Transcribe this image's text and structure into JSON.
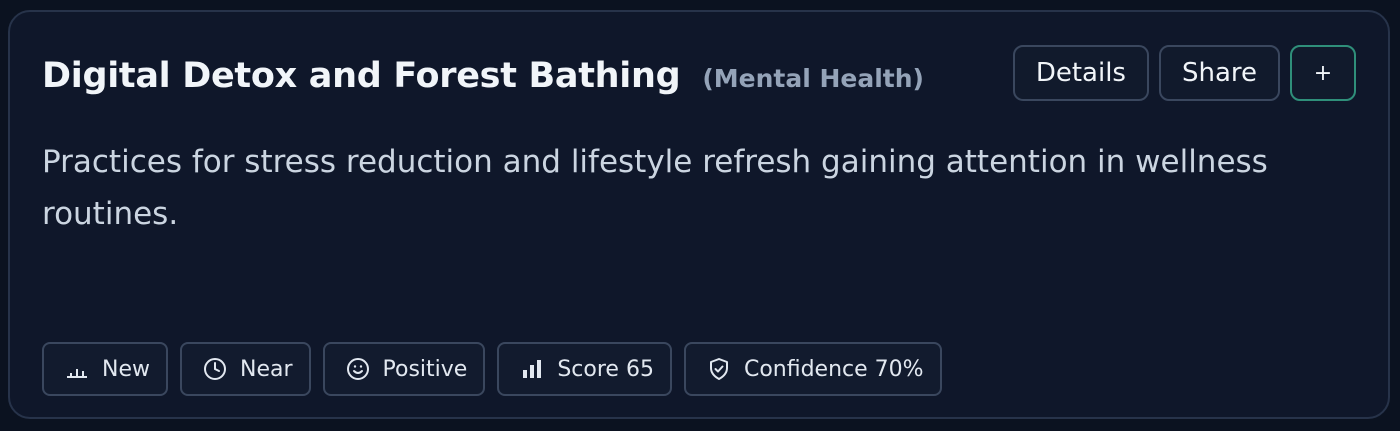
{
  "card": {
    "title": "Digital Detox and Forest Bathing",
    "category": "(Mental Health)",
    "description": "Practices for stress reduction and lifestyle refresh gaining attention in wellness routines.",
    "actions": {
      "details_label": "Details",
      "share_label": "Share",
      "add_label": "+"
    },
    "tags": [
      {
        "icon": "bar-chart-low-icon",
        "label": "New"
      },
      {
        "icon": "clock-icon",
        "label": "Near"
      },
      {
        "icon": "smile-icon",
        "label": "Positive"
      },
      {
        "icon": "bar-chart-icon",
        "label": "Score 65"
      },
      {
        "icon": "shield-check-icon",
        "label": "Confidence 70%"
      }
    ]
  },
  "colors": {
    "background": "#0b1220",
    "card_background": "#0f172a",
    "card_border": "#27334a",
    "accent_border": "#2f8f7a",
    "title": "#f1f5f9",
    "category": "#94a3b8",
    "description": "#cbd5e1"
  }
}
